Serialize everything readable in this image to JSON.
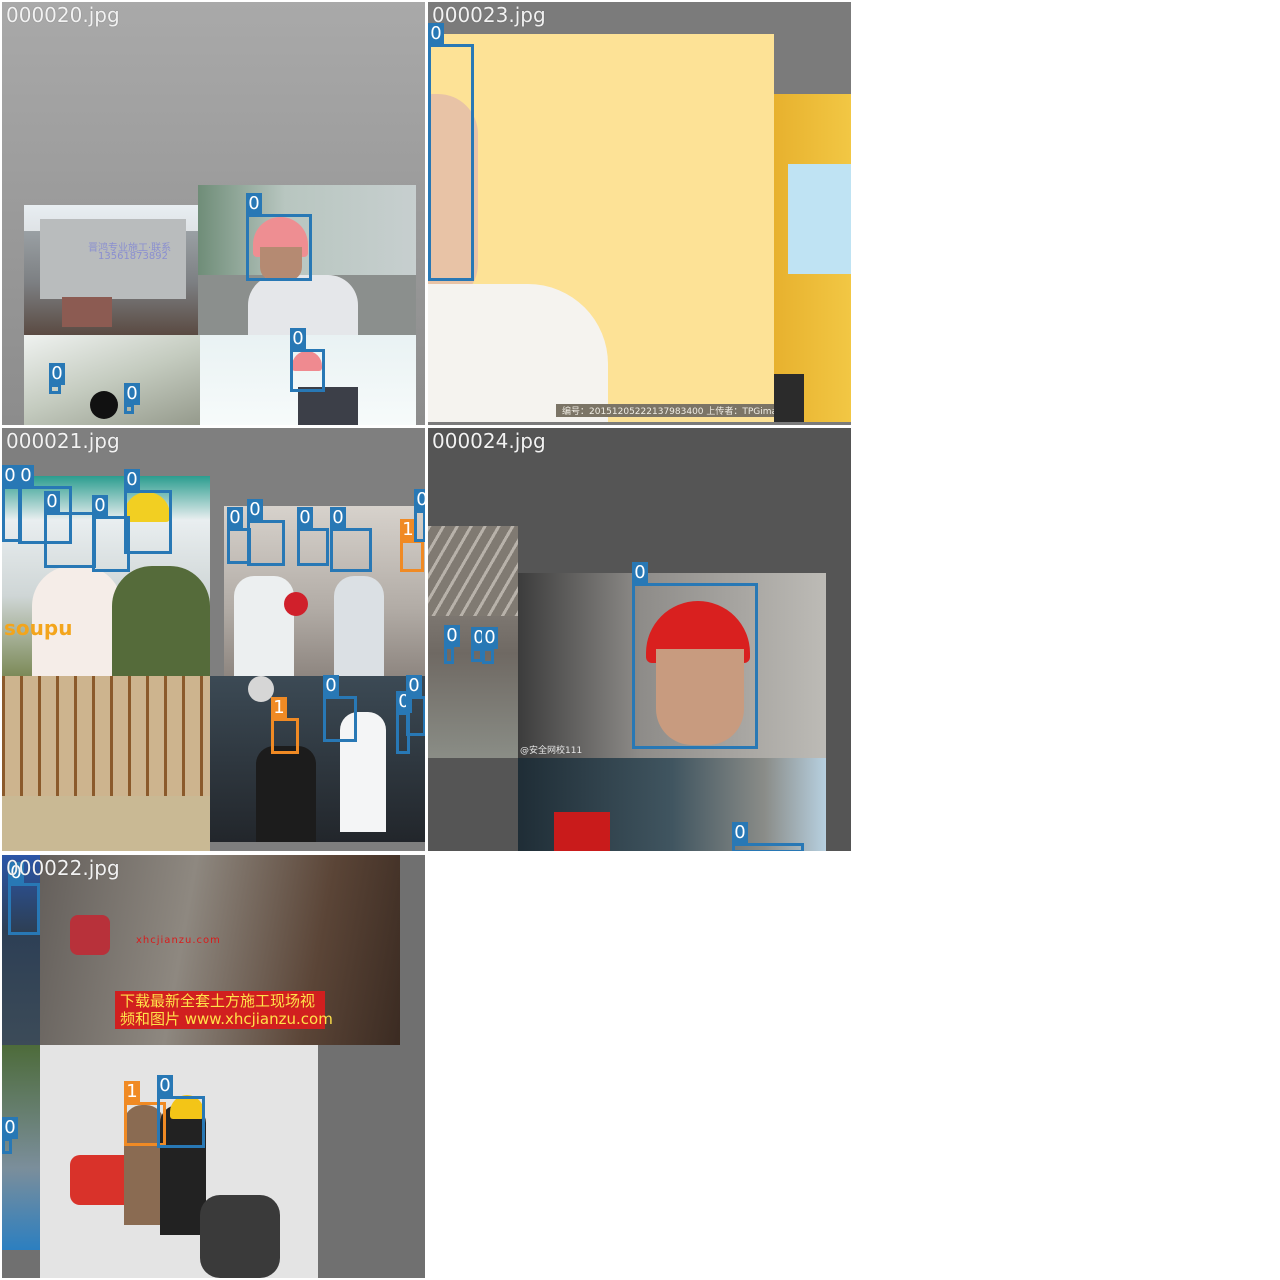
{
  "mosaic": {
    "tiles": [
      {
        "name": "000020.jpg"
      },
      {
        "name": "000023.jpg"
      },
      {
        "name": "000021.jpg"
      },
      {
        "name": "000024.jpg"
      },
      {
        "name": "000022.jpg"
      }
    ]
  },
  "class_labels": {
    "zero": "0",
    "one": "1"
  },
  "colors": {
    "class0": "#2878b5",
    "class1": "#f08a24",
    "pad_light": "#9a9a9a",
    "pad_dark": "#555555"
  },
  "overlays": {
    "t20_building_text": "晋鸿专业施工·联系",
    "t20_building_phone": "13561873892",
    "t23_caption": "编号：20151205222137983400 上传者：TPGimages",
    "t21_logo": "soupu",
    "t24_watermark": "@安全网校111",
    "t22_banner_line1": "下载最新全套土方施工现场视",
    "t22_banner_line2": "频和图片 www.xhcjianzu.com",
    "t22_site_text": "xhcjianzu.com"
  },
  "icons": [
    "image-thumbnail-icon"
  ]
}
